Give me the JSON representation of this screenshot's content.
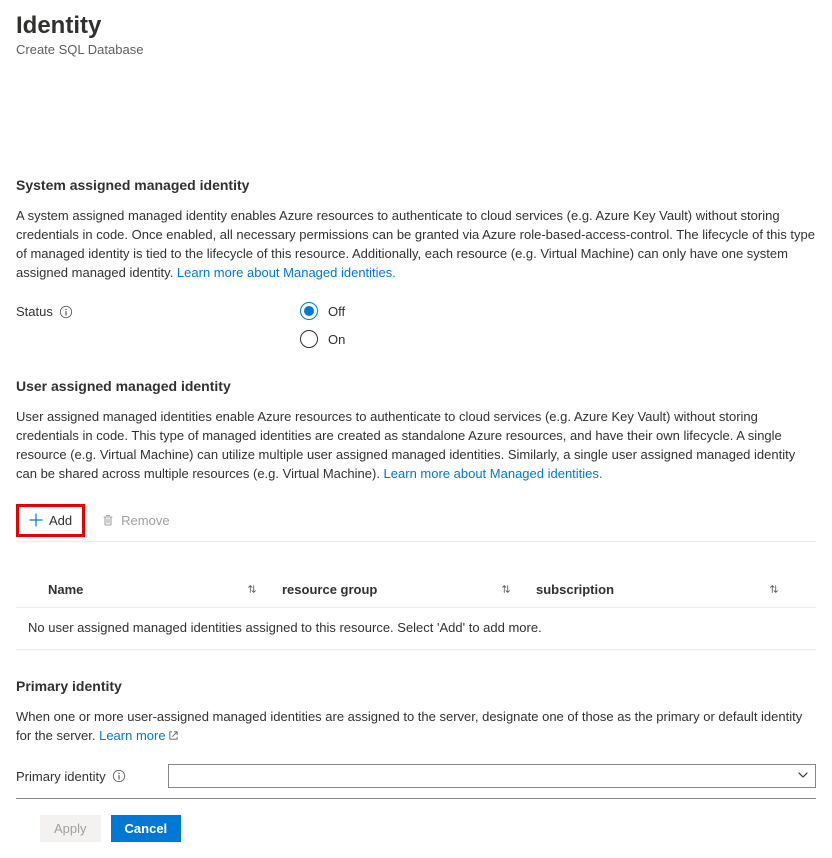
{
  "header": {
    "title": "Identity",
    "subtitle": "Create SQL Database"
  },
  "systemAssigned": {
    "heading": "System assigned managed identity",
    "description": "A system assigned managed identity enables Azure resources to authenticate to cloud services (e.g. Azure Key Vault) without storing credentials in code. Once enabled, all necessary permissions can be granted via Azure role-based-access-control. The lifecycle of this type of managed identity is tied to the lifecycle of this resource. Additionally, each resource (e.g. Virtual Machine) can only have one system assigned managed identity. ",
    "learnMore": "Learn more about Managed identities.",
    "statusLabel": "Status",
    "options": {
      "off": "Off",
      "on": "On"
    },
    "selected": "off"
  },
  "userAssigned": {
    "heading": "User assigned managed identity",
    "description": "User assigned managed identities enable Azure resources to authenticate to cloud services (e.g. Azure Key Vault) without storing credentials in code. This type of managed identities are created as standalone Azure resources, and have their own lifecycle. A single resource (e.g. Virtual Machine) can utilize multiple user assigned managed identities. Similarly, a single user assigned managed identity can be shared across multiple resources (e.g. Virtual Machine). ",
    "learnMore": "Learn more about Managed identities.",
    "addLabel": "Add",
    "removeLabel": "Remove",
    "columns": [
      "Name",
      "resource group",
      "subscription"
    ],
    "emptyMessage": "No user assigned managed identities assigned to this resource. Select 'Add' to add more."
  },
  "primaryIdentity": {
    "heading": "Primary identity",
    "description": "When one or more user-assigned managed identities are assigned to the server, designate one of those as the primary or default identity for the server. ",
    "learnMore": "Learn more",
    "dropdownLabel": "Primary identity",
    "selected": ""
  },
  "footer": {
    "apply": "Apply",
    "cancel": "Cancel"
  }
}
